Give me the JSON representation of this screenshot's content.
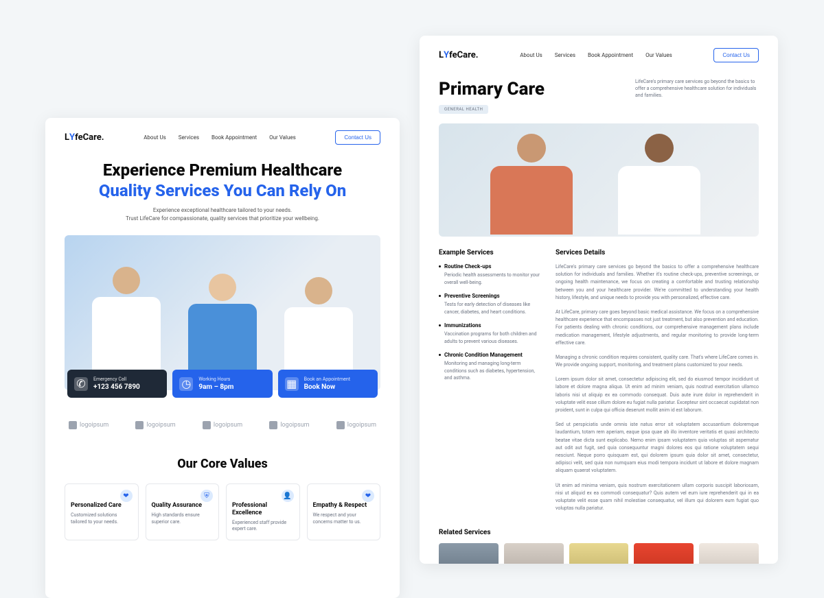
{
  "brand": {
    "prefix": "L",
    "mid": "Y",
    "suffix": "feCare."
  },
  "nav": {
    "about": "About Us",
    "services": "Services",
    "book": "Book Appointment",
    "values": "Our Values",
    "contact": "Contact Us"
  },
  "hero": {
    "line1": "Experience Premium Healthcare",
    "line2": "Quality Services You Can Rely On",
    "sub1": "Experience exceptional healthcare tailored to your needs.",
    "sub2": "Trust LifeCare for compassionate, quality services that prioritize your wellbeing."
  },
  "cta": {
    "emergency_label": "Emergency Call",
    "emergency_value": "+123 456 7890",
    "hours_label": "Working Hours",
    "hours_value": "9am – 8pm",
    "book_label": "Book an Appointment",
    "book_value": "Book Now"
  },
  "logos": [
    "logoipsum",
    "logoipsum",
    "logoipsum",
    "logoipsum",
    "logoipsum"
  ],
  "core_values_heading": "Our Core Values",
  "values": [
    {
      "title": "Personalized Care",
      "desc": "Customized solutions tailored to your needs."
    },
    {
      "title": "Quality Assurance",
      "desc": "High standards ensure superior care."
    },
    {
      "title": "Professional Excellence",
      "desc": "Experienced staff provide expert care."
    },
    {
      "title": "Empathy & Respect",
      "desc": "We respect and your concerns matter to us."
    }
  ],
  "pc": {
    "title": "Primary Care",
    "intro": "LifeCare's primary care services go beyond the basics to offer a comprehensive healthcare solution for individuals and families.",
    "tag": "GENERAL HEALTH",
    "example_heading": "Example Services",
    "details_heading": "Services Details",
    "services": [
      {
        "t": "Routine Check-ups",
        "d": "Periodic health assessments to monitor your overall well-being."
      },
      {
        "t": "Preventive Screenings",
        "d": "Tests for early detection of diseases like cancer, diabetes, and heart conditions."
      },
      {
        "t": "Immunizations",
        "d": "Vaccination programs for both children and adults to prevent various diseases."
      },
      {
        "t": "Chronic Condition Management",
        "d": "Monitoring and managing long-term conditions such as diabetes, hypertension, and asthma."
      }
    ],
    "paras": [
      "LifeCare's primary care services go beyond the basics to offer a comprehensive healthcare solution for individuals and families. Whether it's routine check-ups, preventive screenings, or ongoing health maintenance, we focus on creating a comfortable and trusting relationship between you and your healthcare provider. We're committed to understanding your health history, lifestyle, and unique needs to provide you with personalized, effective care.",
      "At LifeCare, primary care goes beyond basic medical assistance. We focus on a comprehensive healthcare experience that encompasses not just treatment, but also prevention and education. For patients dealing with chronic conditions, our comprehensive management plans include medication management, lifestyle adjustments, and regular monitoring to provide long-term effective care.",
      "Managing a chronic condition requires consistent, quality care. That's where LifeCare comes in. We provide ongoing support, monitoring, and treatment plans customized to your needs.",
      "Lorem ipsum dolor sit amet, consectetur adipiscing elit, sed do eiusmod tempor incididunt ut labore et dolore magna aliqua. Ut enim ad minim veniam, quis nostrud exercitation ullamco laboris nisi ut aliquip ex ea commodo consequat. Duis aute irure dolor in reprehenderit in voluptate velit esse cillum dolore eu fugiat nulla pariatur. Excepteur sint occaecat cupidatat non proident, sunt in culpa qui officia deserunt mollit anim id est laborum.",
      "Sed ut perspiciatis unde omnis iste natus error sit voluptatem accusantium doloremque laudantium, totam rem aperiam, eaque ipsa quae ab illo inventore veritatis et quasi architecto beatae vitae dicta sunt explicabo. Nemo enim ipsam voluptatem quia voluptas sit aspernatur aut odit aut fugit, sed quia consequuntur magni dolores eos qui ratione voluptatem sequi nesciunt. Neque porro quisquam est, qui dolorem ipsum quia dolor sit amet, consectetur, adipisci velit, sed quia non numquam eius modi tempora incidunt ut labore et dolore magnam aliquam quaerat voluptatem.",
      "Ut enim ad minima veniam, quis nostrum exercitationem ullam corporis suscipit laboriosam, nisi ut aliquid ex ea commodi consequatur? Quis autem vel eum iure reprehenderit qui in ea voluptate velit esse quam nihil molestiae consequatur, vel illum qui dolorem eum fugiat quo voluptas nulla pariatur."
    ],
    "related_heading": "Related Services"
  }
}
